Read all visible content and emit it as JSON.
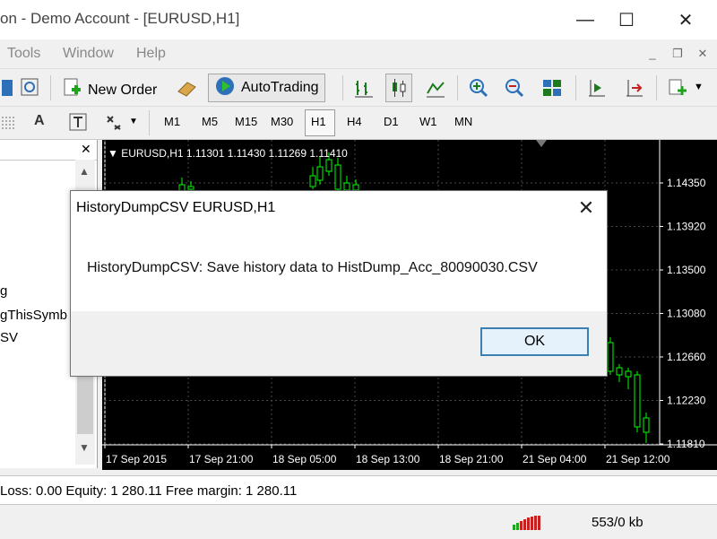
{
  "window": {
    "title": "on - Demo Account - [EURUSD,H1]",
    "controls": {
      "minimize": "—",
      "maximize": "☐",
      "close": "✕"
    }
  },
  "menu": {
    "items": [
      "Tools",
      "Window",
      "Help"
    ],
    "mdi": {
      "minimize": "_",
      "restore": "❐",
      "close": "✕"
    }
  },
  "toolbar": {
    "new_order": "New Order",
    "auto_trading": "AutoTrading"
  },
  "timeframes": [
    "M1",
    "M5",
    "M15",
    "M30",
    "H1",
    "H4",
    "D1",
    "W1",
    "MN"
  ],
  "active_timeframe": "H1",
  "left_panel": {
    "close": "✕",
    "items": [
      "g",
      "gThisSymb",
      "SV"
    ]
  },
  "chart": {
    "header": "EURUSD,H1  1.11301 1.11430 1.11269 1.11410",
    "price_labels": [
      "1.14350",
      "1.13920",
      "1.13500",
      "1.13080",
      "1.12660",
      "1.12230",
      "1.11810"
    ],
    "time_labels": [
      "17 Sep 2015",
      "17 Sep 21:00",
      "18 Sep 05:00",
      "18 Sep 13:00",
      "18 Sep 21:00",
      "21 Sep 04:00",
      "21 Sep 12:00"
    ],
    "colors": {
      "bg": "#000000",
      "bull": "#00ff00",
      "grid": "#4a4a4a",
      "text": "#ffffff"
    }
  },
  "dialog": {
    "title": "HistoryDumpCSV EURUSD,H1",
    "close": "✕",
    "message": "HistoryDumpCSV: Save history data to HistDump_Acc_80090030.CSV",
    "ok": "OK"
  },
  "account_bar": {
    "text": "Loss: 0.00  Equity: 1 280.11  Free margin: 1 280.11"
  },
  "status_bar": {
    "traffic": "553/0 kb"
  }
}
